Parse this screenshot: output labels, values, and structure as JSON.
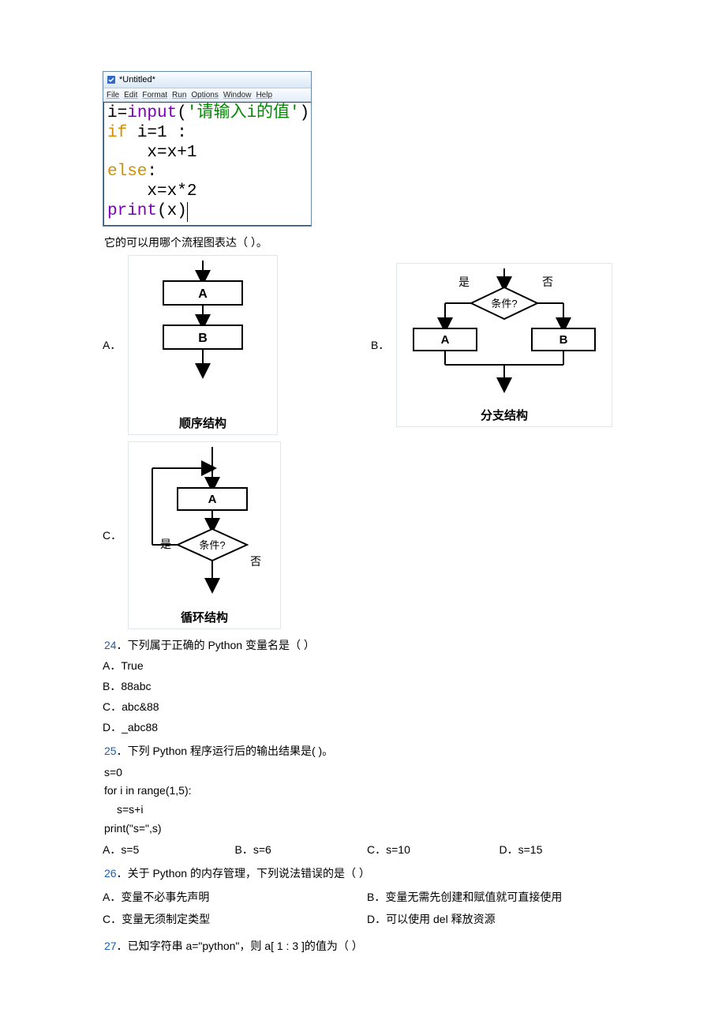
{
  "codeWindow": {
    "title": "*Untitled*",
    "menu": [
      "File",
      "Edit",
      "Format",
      "Run",
      "Options",
      "Window",
      "Help"
    ],
    "lines": {
      "l1a": "i=",
      "l1b": "input",
      "l1c": "(",
      "l1d": "'请输入i的值'",
      "l1e": ")",
      "l2a": "if",
      "l2b": " i=1 :",
      "l3": "x=x+1",
      "l4": "else",
      "l4b": ":",
      "l5": "x=x*2",
      "l6a": "print",
      "l6b": "(x)"
    }
  },
  "q23": {
    "stem": "它的可以用哪个流程图表达（  ）。",
    "optA": "A．",
    "optB": "B．",
    "optC": "C．",
    "capA": "顺序结构",
    "capB": "分支结构",
    "capC": "循环结构",
    "labelA": "A",
    "labelB": "B",
    "cond": "条件?",
    "yes": "是",
    "no": "否"
  },
  "q24": {
    "num": "24",
    "stem": "．下列属于正确的 Python 变量名是（  ）",
    "A": "A．True",
    "B": "B．88abc",
    "C": "C．abc&88",
    "D": "D．_abc88"
  },
  "q25": {
    "num": "25",
    "stem": "．下列 Python 程序运行后的输出结果是(   )。",
    "code1": "s=0",
    "code2": "for i in range(1,5):",
    "code3": "s=s+i",
    "code4": "print(\"s=\",s)",
    "A": "A．s=5",
    "B": "B．s=6",
    "C": "C．s=10",
    "D": "D．s=15"
  },
  "q26": {
    "num": "26",
    "stem": "．关于 Python 的内存管理，下列说法错误的是（     ）",
    "A": "A．变量不必事先声明",
    "B": "B．变量无需先创建和赋值就可直接使用",
    "C": "C．变量无须制定类型",
    "D": "D．可以使用 del 释放资源"
  },
  "q27": {
    "num": "27",
    "stem": "．已知字符串 a=\"python\"，则 a[ 1 : 3 ]的值为（  ）"
  }
}
